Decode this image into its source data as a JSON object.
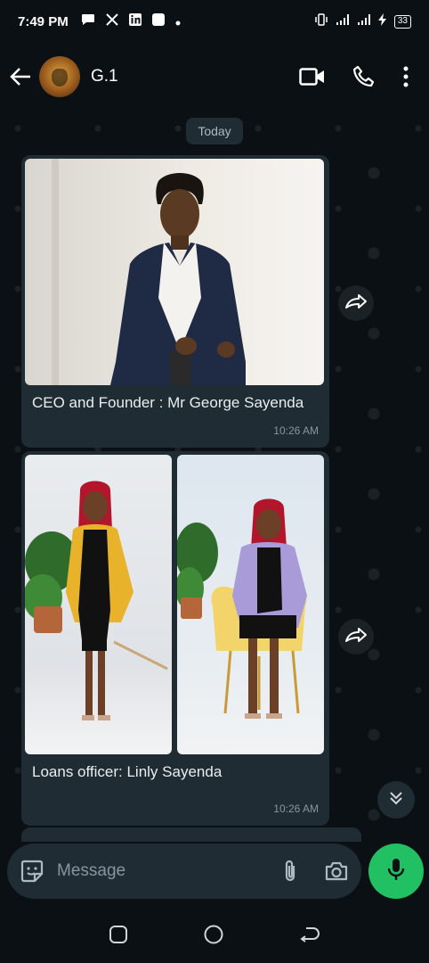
{
  "status_bar": {
    "time": "7:49 PM",
    "battery": "33"
  },
  "header": {
    "contact_name": "G.1",
    "icons": [
      "back-arrow-icon",
      "video-call-icon",
      "phone-icon",
      "more-vertical-icon"
    ]
  },
  "chat": {
    "date_chip": "Today",
    "messages": [
      {
        "caption": "CEO and Founder : Mr George Sayenda",
        "time": "10:26 AM",
        "photos": [
          "man-in-navy-suit-photo"
        ]
      },
      {
        "caption": "Loans officer: Linly Sayenda",
        "time": "10:26 AM",
        "photos": [
          "woman-yellow-blazer-photo",
          "woman-purple-blazer-photo"
        ]
      }
    ]
  },
  "composer": {
    "placeholder": "Message"
  },
  "colors": {
    "background": "#0b1014",
    "bubble": "#1f2c33",
    "accent_green": "#21c063",
    "secondary_text": "#8696a0"
  }
}
